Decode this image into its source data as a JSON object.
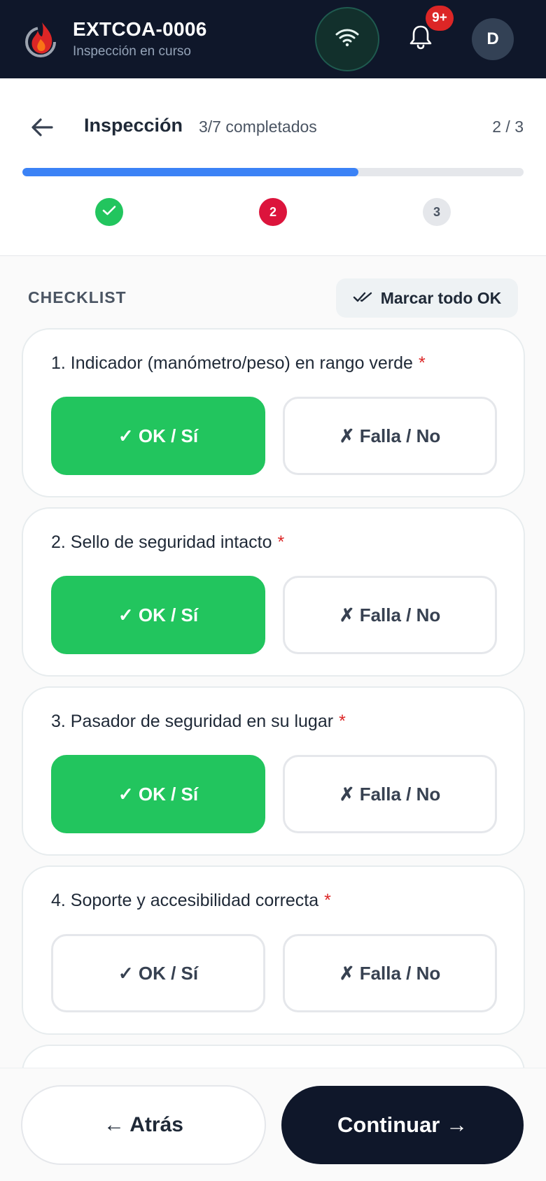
{
  "header": {
    "app_title": "EXTCOA-0006",
    "subtitle": "Inspección en curso",
    "notification_badge": "9+",
    "avatar_initial": "D",
    "icons": {
      "logo": "flame-logo-icon",
      "wifi": "wifi-icon",
      "bell": "bell-icon"
    }
  },
  "inspection": {
    "title": "Inspección",
    "completed_text": "3/7 completados",
    "step_text": "2 / 3",
    "progress": 0.67,
    "steps": [
      {
        "label": "",
        "state": "done"
      },
      {
        "label": "2",
        "state": "active"
      },
      {
        "label": "3",
        "state": "pending"
      }
    ]
  },
  "checklist": {
    "label": "CHECKLIST",
    "mark_all_label": "Marcar todo OK",
    "required_mark": "*",
    "ok_label": "✓ OK / Sí",
    "fail_label": "✗ Falla / No",
    "items": [
      {
        "question": "1. Indicador (manómetro/peso) en rango verde",
        "selected": "ok"
      },
      {
        "question": "2. Sello de seguridad intacto",
        "selected": "ok"
      },
      {
        "question": "3. Pasador de seguridad en su lugar",
        "selected": "ok"
      },
      {
        "question": "4. Soporte y accesibilidad correcta",
        "selected": ""
      }
    ]
  },
  "footer": {
    "back_label": "← Atrás",
    "continue_label": "Continuar →"
  },
  "colors": {
    "topbar": "#0f172a",
    "ok_green": "#22c55e",
    "accent_red": "#dc143c",
    "progress_blue": "#3b82f6"
  }
}
